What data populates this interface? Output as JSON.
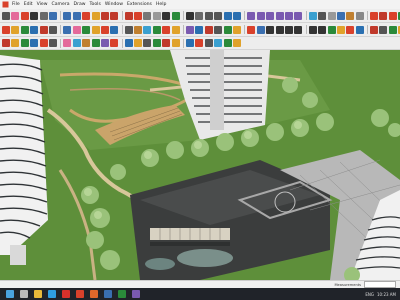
{
  "menu": {
    "items": [
      "File",
      "Edit",
      "View",
      "Camera",
      "Draw",
      "Tools",
      "Window",
      "Extensions",
      "Help"
    ]
  },
  "toolbar": {
    "row1": [
      {
        "icon": "select-icon",
        "color": "#555"
      },
      {
        "icon": "eraser-icon",
        "color": "#e46a9a"
      },
      {
        "icon": "paint-icon",
        "color": "#d9412b"
      },
      {
        "icon": "line-icon",
        "color": "#333"
      },
      {
        "icon": "freehand-icon",
        "color": "#6a6a6a"
      },
      {
        "icon": "rectangle-icon",
        "color": "#3a6fb0"
      },
      {
        "icon": "circle-icon",
        "color": "#3a6fb0"
      },
      {
        "icon": "polygon-icon",
        "color": "#3a6fb0"
      },
      {
        "icon": "arc-icon",
        "color": "#d9412b"
      },
      {
        "icon": "push-pull-icon",
        "color": "#e0a22a"
      },
      {
        "icon": "move-icon",
        "color": "#c0392b"
      },
      {
        "icon": "rotate-icon",
        "color": "#c0392b"
      },
      {
        "icon": "scale-icon",
        "color": "#c0392b"
      },
      {
        "icon": "offset-icon",
        "color": "#d9412b"
      },
      {
        "icon": "tape-icon",
        "color": "#777"
      },
      {
        "icon": "protractor-icon",
        "color": "#999"
      },
      {
        "icon": "text-icon",
        "color": "#333"
      },
      {
        "icon": "axes-icon",
        "color": "#2a8a3a"
      },
      {
        "icon": "orbit-icon",
        "color": "#333"
      },
      {
        "icon": "pan-icon",
        "color": "#6a6a6a"
      },
      {
        "icon": "zoom-icon",
        "color": "#555"
      },
      {
        "icon": "zoom-extents-icon",
        "color": "#555"
      },
      {
        "icon": "previous-view-icon",
        "color": "#2a6fb0"
      },
      {
        "icon": "next-view-icon",
        "color": "#2a6fb0"
      },
      {
        "icon": "iso-view-icon",
        "color": "#7a5ab0"
      },
      {
        "icon": "top-view-icon",
        "color": "#7a5ab0"
      },
      {
        "icon": "front-view-icon",
        "color": "#7a5ab0"
      },
      {
        "icon": "right-view-icon",
        "color": "#7a5ab0"
      },
      {
        "icon": "back-view-icon",
        "color": "#7a5ab0"
      },
      {
        "icon": "left-view-icon",
        "color": "#7a5ab0"
      },
      {
        "icon": "xray-icon",
        "color": "#3aa0d0"
      },
      {
        "icon": "wireframe-icon",
        "color": "#555"
      },
      {
        "icon": "hidden-line-icon",
        "color": "#999"
      },
      {
        "icon": "shaded-icon",
        "color": "#3a6fb0"
      },
      {
        "icon": "textured-icon",
        "color": "#c08030"
      },
      {
        "icon": "monochrome-icon",
        "color": "#888"
      },
      {
        "icon": "section-plane-icon",
        "color": "#d9412b"
      },
      {
        "icon": "magnet-icon",
        "color": "#c0392b"
      },
      {
        "icon": "warehouse-icon",
        "color": "#d9412b"
      },
      {
        "icon": "extension-icon",
        "color": "#2a8a3a"
      },
      {
        "icon": "layers-icon",
        "color": "#e0a22a"
      },
      {
        "icon": "components-icon",
        "color": "#2a6fb0"
      }
    ],
    "row2": [
      {
        "icon": "plugin-a-icon",
        "color": "#d9412b"
      },
      {
        "icon": "plugin-b-icon",
        "color": "#e0a22a"
      },
      {
        "icon": "plugin-c-icon",
        "color": "#2a8a3a"
      },
      {
        "icon": "plugin-d-icon",
        "color": "#2a6fb0"
      },
      {
        "icon": "plugin-e-icon",
        "color": "#c0392b"
      },
      {
        "icon": "plugin-f-icon",
        "color": "#555"
      },
      {
        "icon": "plugin-g-icon",
        "color": "#3a6fb0"
      },
      {
        "icon": "plugin-h-icon",
        "color": "#e46a9a"
      },
      {
        "icon": "plugin-i-icon",
        "color": "#2a8a3a"
      },
      {
        "icon": "plugin-j-icon",
        "color": "#e0a22a"
      },
      {
        "icon": "plugin-k-icon",
        "color": "#d9412b"
      },
      {
        "icon": "plugin-l-icon",
        "color": "#2a6fb0"
      },
      {
        "icon": "plugin-m-icon",
        "color": "#555"
      },
      {
        "icon": "plugin-n-icon",
        "color": "#c08030"
      },
      {
        "icon": "plugin-o-icon",
        "color": "#3aa0d0"
      },
      {
        "icon": "plugin-p-icon",
        "color": "#2a8a3a"
      },
      {
        "icon": "plugin-q-icon",
        "color": "#d9412b"
      },
      {
        "icon": "plugin-r-icon",
        "color": "#e0a22a"
      },
      {
        "icon": "plugin-s-icon",
        "color": "#7a5ab0"
      },
      {
        "icon": "plugin-t-icon",
        "color": "#2a6fb0"
      },
      {
        "icon": "plugin-u-icon",
        "color": "#c0392b"
      },
      {
        "icon": "plugin-v-icon",
        "color": "#555"
      },
      {
        "icon": "plugin-w-icon",
        "color": "#2a8a3a"
      },
      {
        "icon": "plugin-x-icon",
        "color": "#e0a22a"
      },
      {
        "icon": "plugin-y-icon",
        "color": "#d9412b"
      },
      {
        "icon": "plugin-z-icon",
        "color": "#3a6fb0"
      },
      {
        "icon": "ring-icon",
        "color": "#333"
      },
      {
        "icon": "ring-icon",
        "color": "#333"
      },
      {
        "icon": "ring-icon",
        "color": "#333"
      },
      {
        "icon": "ring-icon",
        "color": "#333"
      },
      {
        "icon": "ring-icon",
        "color": "#333"
      },
      {
        "icon": "ring-icon",
        "color": "#333"
      },
      {
        "icon": "shape-icon",
        "color": "#2a8a3a"
      },
      {
        "icon": "shape-icon",
        "color": "#e0a22a"
      },
      {
        "icon": "shape-icon",
        "color": "#d9412b"
      },
      {
        "icon": "shape-icon",
        "color": "#2a6fb0"
      },
      {
        "icon": "shape-icon",
        "color": "#c0392b"
      },
      {
        "icon": "shape-icon",
        "color": "#555"
      },
      {
        "icon": "shape-icon",
        "color": "#2a8a3a"
      },
      {
        "icon": "shape-icon",
        "color": "#e0a22a"
      },
      {
        "icon": "shape-icon",
        "color": "#d9412b"
      }
    ],
    "row3": [
      {
        "icon": "tool-1-icon",
        "color": "#c0392b"
      },
      {
        "icon": "tool-2-icon",
        "color": "#e0a22a"
      },
      {
        "icon": "tool-3-icon",
        "color": "#2a8a3a"
      },
      {
        "icon": "tool-4-icon",
        "color": "#2a6fb0"
      },
      {
        "icon": "tool-5-icon",
        "color": "#d9412b"
      },
      {
        "icon": "tool-6-icon",
        "color": "#555"
      },
      {
        "icon": "tool-7-icon",
        "color": "#e46a9a"
      },
      {
        "icon": "tool-8-icon",
        "color": "#3aa0d0"
      },
      {
        "icon": "tool-9-icon",
        "color": "#c08030"
      },
      {
        "icon": "tool-10-icon",
        "color": "#2a8a3a"
      },
      {
        "icon": "tool-11-icon",
        "color": "#7a5ab0"
      },
      {
        "icon": "tool-12-icon",
        "color": "#d9412b"
      },
      {
        "icon": "tool-13-icon",
        "color": "#2a6fb0"
      },
      {
        "icon": "tool-14-icon",
        "color": "#e0a22a"
      },
      {
        "icon": "tool-15-icon",
        "color": "#555"
      },
      {
        "icon": "tool-16-icon",
        "color": "#2a8a3a"
      },
      {
        "icon": "tool-17-icon",
        "color": "#c0392b"
      },
      {
        "icon": "tool-18-icon",
        "color": "#e0a22a"
      },
      {
        "icon": "tool-19-icon",
        "color": "#2a6fb0"
      },
      {
        "icon": "tool-20-icon",
        "color": "#d9412b"
      },
      {
        "icon": "tool-21-icon",
        "color": "#555"
      },
      {
        "icon": "tool-22-icon",
        "color": "#3aa0d0"
      },
      {
        "icon": "tool-23-icon",
        "color": "#2a8a3a"
      },
      {
        "icon": "tool-24-icon",
        "color": "#e0a22a"
      }
    ]
  },
  "status": {
    "measurements_label": "Measurements"
  },
  "taskbar": {
    "apps": [
      {
        "icon": "windows-start-icon",
        "color": "#4aa3df"
      },
      {
        "icon": "search-icon",
        "color": "#bbb"
      },
      {
        "icon": "file-explorer-icon",
        "color": "#e8b93a"
      },
      {
        "icon": "edge-browser-icon",
        "color": "#2f9ee0"
      },
      {
        "icon": "acrobat-icon",
        "color": "#d9312b"
      },
      {
        "icon": "sketchup-icon",
        "color": "#d9412b"
      },
      {
        "icon": "app-icon",
        "color": "#e0672a"
      },
      {
        "icon": "app-icon",
        "color": "#3a6fb0"
      },
      {
        "icon": "app-icon",
        "color": "#2a8a3a"
      },
      {
        "icon": "app-icon",
        "color": "#7a5ab0"
      }
    ],
    "tray_language": "ENG",
    "tray_time": "10:23 AM"
  },
  "scene_colors": {
    "lawn": "#5e8f3a",
    "lawn_dark": "#4a7830",
    "path": "#c9a86a",
    "building_white": "#f1f1f1",
    "building_line": "#2f3336",
    "roof_dark": "#3b3d3d",
    "water": "#7a8f8a",
    "tree": "#9ac27a",
    "sky_edge": "#8fa880"
  }
}
